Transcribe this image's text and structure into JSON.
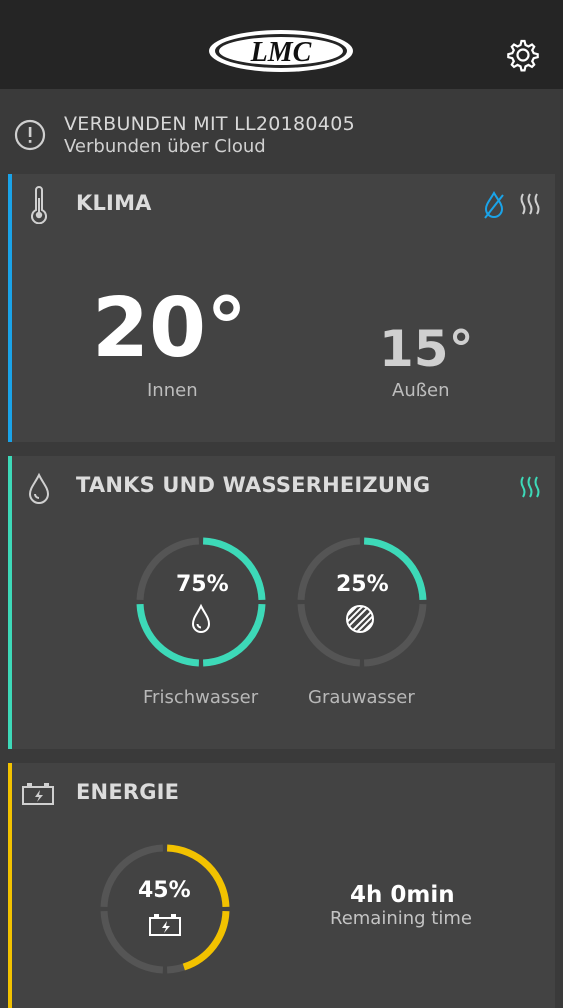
{
  "header": {
    "logo_text": "LMC"
  },
  "status": {
    "line1": "VERBUNDEN MIT LL20180405",
    "line2": "Verbunden über Cloud"
  },
  "klima": {
    "title": "KLIMA",
    "inside_temp": "20°",
    "inside_label": "Innen",
    "outside_temp": "15°",
    "outside_label": "Außen",
    "accent_color": "#1aa3e8"
  },
  "tanks": {
    "title": "TANKS UND WASSERHEIZUNG",
    "accent_color": "#3dd9b8",
    "fresh": {
      "percent_text": "75%",
      "percent": 75,
      "label": "Frischwasser"
    },
    "grey": {
      "percent_text": "25%",
      "percent": 25,
      "label": "Grauwasser"
    }
  },
  "energie": {
    "title": "ENERGIE",
    "accent_color": "#f2c200",
    "battery": {
      "percent_text": "45%",
      "percent": 45
    },
    "remaining_value": "4h 0min",
    "remaining_label": "Remaining time"
  }
}
